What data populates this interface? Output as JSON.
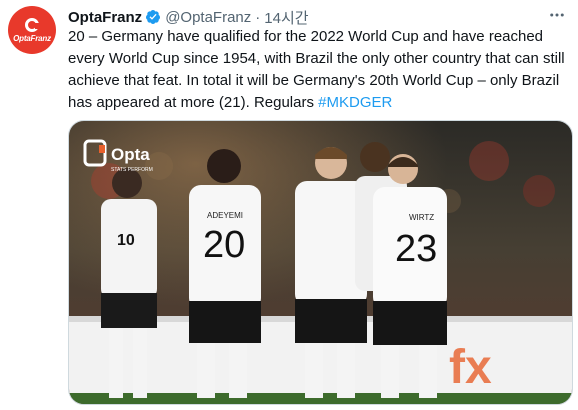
{
  "tweet": {
    "author": {
      "display_name": "OptaFranz",
      "handle": "@OptaFranz",
      "verified": true,
      "avatar_text": "OptaFranz",
      "avatar_color": "#e8392b"
    },
    "separator": "·",
    "time": "14시간",
    "more_icon": "ellipsis-icon",
    "body_text": "20 – Germany have qualified for the 2022 World Cup and have reached every World Cup since 1954, with Brazil the only other country that can still achieve that feat. In total it will be Germany's 20th World Cup – only Brazil has appeared at more (21). Regulars ",
    "hashtag": "#MKDGER",
    "media": {
      "watermark": "Opta",
      "watermark_sub": "STATS PERFORM",
      "jersey_numbers": [
        "10",
        "20",
        "23"
      ],
      "jersey_names": [
        "ADEYEMI",
        "WIRTZ"
      ],
      "board_text": "fx"
    }
  },
  "colors": {
    "link": "#1d9bf0",
    "secondary_text": "#536471",
    "verified": "#1d9bf0"
  }
}
